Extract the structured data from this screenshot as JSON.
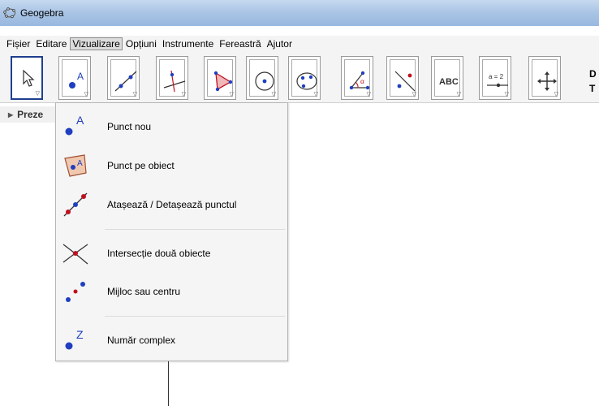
{
  "window": {
    "title": "Geogebra"
  },
  "menu": [
    "Fișier",
    "Editare",
    "Vizualizare",
    "Opțiuni",
    "Instrumente",
    "Fereastră",
    "Ajutor"
  ],
  "menu_active_index": 2,
  "toolbar": {
    "tools": [
      {
        "name": "move-tool",
        "icon": "cursor-arrow-icon"
      },
      {
        "name": "new-point-tool",
        "icon": "point-a-icon",
        "label": "A"
      },
      {
        "name": "line-tool",
        "icon": "line-through-points-icon"
      },
      {
        "name": "perpendicular-tool",
        "icon": "perpendicular-line-icon"
      },
      {
        "name": "polygon-tool",
        "icon": "polygon-icon"
      },
      {
        "name": "circle-tool",
        "icon": "circle-center-point-icon"
      },
      {
        "name": "conic-tool",
        "icon": "ellipse-icon"
      },
      {
        "name": "angle-tool",
        "icon": "angle-icon",
        "label": "α"
      },
      {
        "name": "reflect-tool",
        "icon": "reflect-line-icon"
      },
      {
        "name": "text-tool",
        "icon": "text-abc-icon",
        "label": "ABC"
      },
      {
        "name": "slider-tool",
        "icon": "slider-icon",
        "label": "a = 2"
      },
      {
        "name": "move-view-tool",
        "icon": "move-graphics-view-icon"
      }
    ],
    "right_text_1": "D",
    "right_text_2": "T"
  },
  "algebra_header": {
    "label": "Preze"
  },
  "dropdown": {
    "items": [
      {
        "label": "Punct nou",
        "icon": "new-point-icon",
        "icon_text": "A"
      },
      {
        "label": "Punct pe obiect",
        "icon": "point-on-object-icon",
        "icon_text": "A"
      },
      {
        "label": "Atașează / Detașează punctul",
        "icon": "attach-detach-point-icon"
      },
      {
        "label": "Intersecție două obiecte",
        "icon": "intersect-two-objects-icon"
      },
      {
        "label": "Mijloc sau centru",
        "icon": "midpoint-center-icon"
      },
      {
        "label": "Număr complex",
        "icon": "complex-number-icon",
        "icon_text": "Z"
      }
    ]
  },
  "colors": {
    "point_blue": "#1f3fbf",
    "point_red": "#c0101f",
    "selected_border": "#1f3f8f"
  }
}
